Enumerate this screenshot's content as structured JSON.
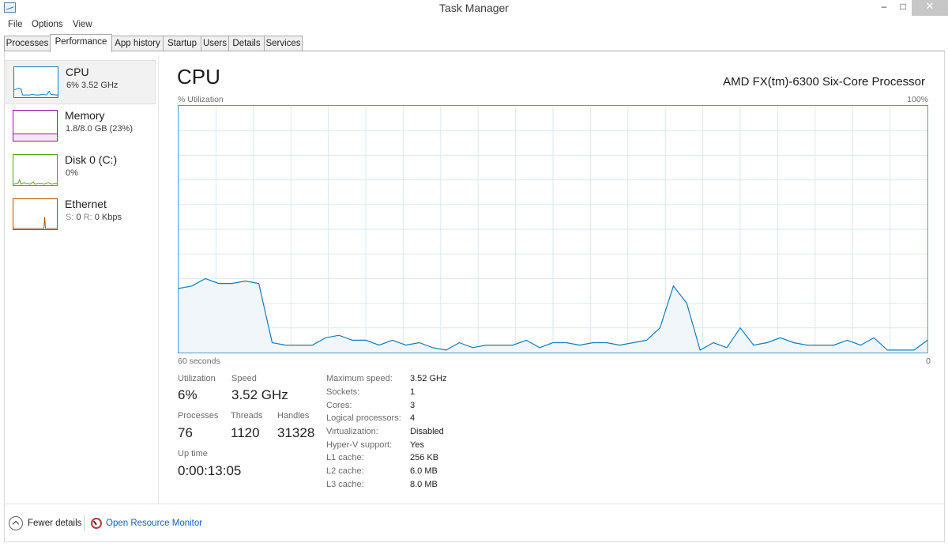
{
  "window": {
    "title": "Task Manager",
    "minimize_glyph": "–",
    "maximize_glyph": "□",
    "close_glyph": "✕"
  },
  "menu": [
    "File",
    "Options",
    "View"
  ],
  "tabs": [
    {
      "label": "Processes",
      "active": false
    },
    {
      "label": "Performance",
      "active": true
    },
    {
      "label": "App history",
      "active": false
    },
    {
      "label": "Startup",
      "active": false
    },
    {
      "label": "Users",
      "active": false
    },
    {
      "label": "Details",
      "active": false
    },
    {
      "label": "Services",
      "active": false
    }
  ],
  "sidebar": {
    "items": [
      {
        "name": "CPU",
        "detail": "6% 3.52 GHz",
        "color": "#117dbb",
        "selected": true
      },
      {
        "name": "Memory",
        "detail": "1.8/8.0 GB (23%)",
        "color": "#8b12ae",
        "selected": false,
        "memory_fill_fraction": 0.23
      },
      {
        "name": "Disk 0 (C:)",
        "detail": "0%",
        "color": "#4da60c",
        "selected": false
      },
      {
        "name": "Ethernet",
        "detail_send_label": "S:",
        "detail_send_value": "0",
        "detail_recv_label": "R:",
        "detail_recv_value": "0 Kbps",
        "color": "#a74f01",
        "selected": false
      }
    ]
  },
  "main": {
    "title": "CPU",
    "processor": "AMD FX(tm)-6300 Six-Core Processor",
    "graph": {
      "y_label": "% Utilization",
      "y_max_label": "100%",
      "x_left_label": "60 seconds",
      "x_right_label": "0",
      "line_color": "#117dbb",
      "fill_color": "#f1f6fa",
      "grid_color": "#d9eaf4",
      "samples": [
        26,
        27,
        30,
        28,
        28,
        29,
        28,
        4,
        3,
        3,
        3,
        6,
        7,
        5,
        5,
        3,
        5,
        3,
        4,
        2,
        1,
        4,
        2,
        3,
        3,
        3,
        5,
        2,
        4,
        4,
        3,
        4,
        4,
        3,
        4,
        5,
        10,
        27,
        20,
        1,
        4,
        2,
        10,
        3,
        4,
        6,
        4,
        3,
        3,
        3,
        5,
        3,
        6,
        1,
        1,
        1,
        5
      ]
    },
    "stats": {
      "utilization_label": "Utilization",
      "utilization_value": "6%",
      "speed_label": "Speed",
      "speed_value": "3.52 GHz",
      "processes_label": "Processes",
      "processes_value": "76",
      "threads_label": "Threads",
      "threads_value": "1120",
      "handles_label": "Handles",
      "handles_value": "31328",
      "uptime_label": "Up time",
      "uptime_value": "0:00:13:05"
    },
    "specs": [
      {
        "key": "Maximum speed:",
        "value": "3.52 GHz"
      },
      {
        "key": "Sockets:",
        "value": "1"
      },
      {
        "key": "Cores:",
        "value": "3"
      },
      {
        "key": "Logical processors:",
        "value": "4"
      },
      {
        "key": "Virtualization:",
        "value": "Disabled"
      },
      {
        "key": "Hyper-V support:",
        "value": "Yes"
      },
      {
        "key": "L1 cache:",
        "value": "256 KB"
      },
      {
        "key": "L2 cache:",
        "value": "6.0 MB"
      },
      {
        "key": "L3 cache:",
        "value": "8.0 MB"
      }
    ]
  },
  "footer": {
    "fewer_details": "Fewer details",
    "resource_monitor": "Open Resource Monitor"
  },
  "icons": {
    "app": "task-manager-icon",
    "fewer": "chevron-up-circle-icon",
    "resource_monitor": "resource-monitor-icon"
  }
}
